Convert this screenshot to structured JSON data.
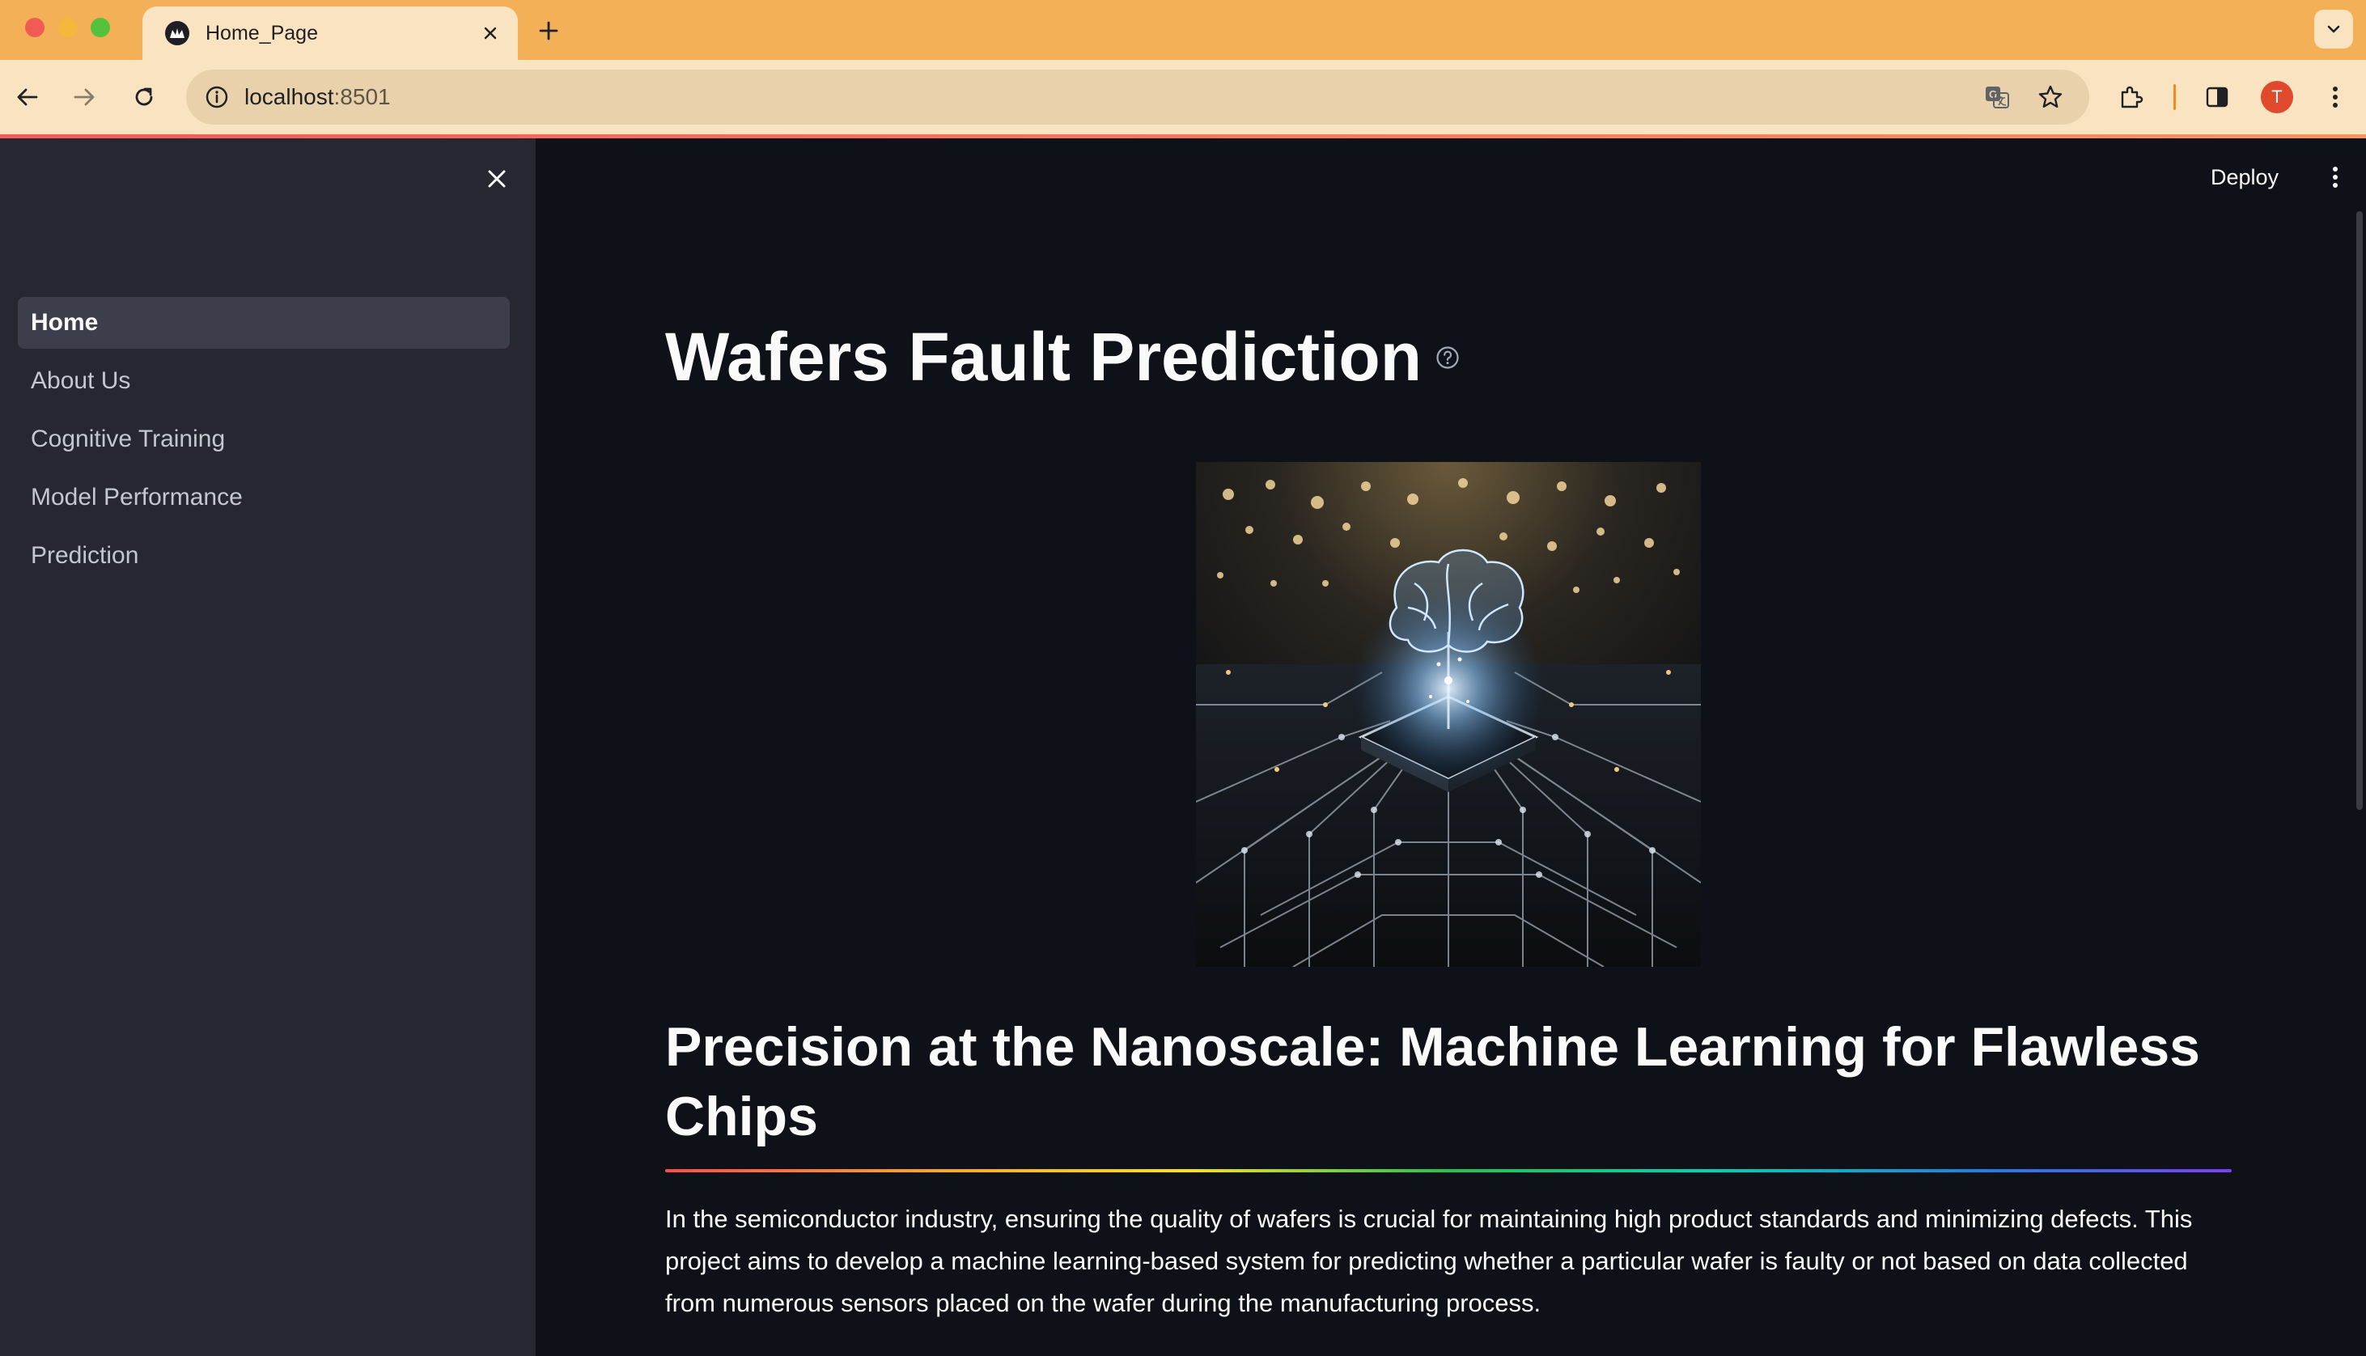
{
  "browser": {
    "tab_title": "Home_Page",
    "url_host": "localhost",
    "url_port": ":8501",
    "profile_initial": "T"
  },
  "app": {
    "header": {
      "deploy_label": "Deploy"
    },
    "sidebar": {
      "items": [
        {
          "label": "Home",
          "active": true
        },
        {
          "label": "About Us",
          "active": false
        },
        {
          "label": "Cognitive Training",
          "active": false
        },
        {
          "label": "Model Performance",
          "active": false
        },
        {
          "label": "Prediction",
          "active": false
        }
      ]
    },
    "main": {
      "title": "Wafers Fault Prediction",
      "subtitle": "Precision at the Nanoscale: Machine Learning for Flawless Chips",
      "description": "In the semiconductor industry, ensuring the quality of wafers is crucial for maintaining high product standards and minimizing defects. This project aims to develop a machine learning-based system for predicting whether a particular wafer is faulty or not based on data collected from numerous sensors placed on the wafer during the manufacturing process."
    }
  },
  "colors": {
    "tabstrip": "#f4b057",
    "toolbar": "#f9e3c1",
    "sidebar_bg": "#262730",
    "main_bg": "#0e1117",
    "text_primary": "#fafafa",
    "accent_red": "#ff4b4b"
  },
  "icons": {
    "browser": [
      "streamlit-favicon-icon",
      "close-icon",
      "plus-icon",
      "chevron-down-icon",
      "back-arrow-icon",
      "forward-arrow-icon",
      "reload-icon",
      "info-icon",
      "translate-icon",
      "star-icon",
      "extensions-icon",
      "side-panel-icon",
      "kebab-menu-icon"
    ],
    "app": [
      "close-icon",
      "help-circle-icon",
      "kebab-menu-icon"
    ]
  }
}
